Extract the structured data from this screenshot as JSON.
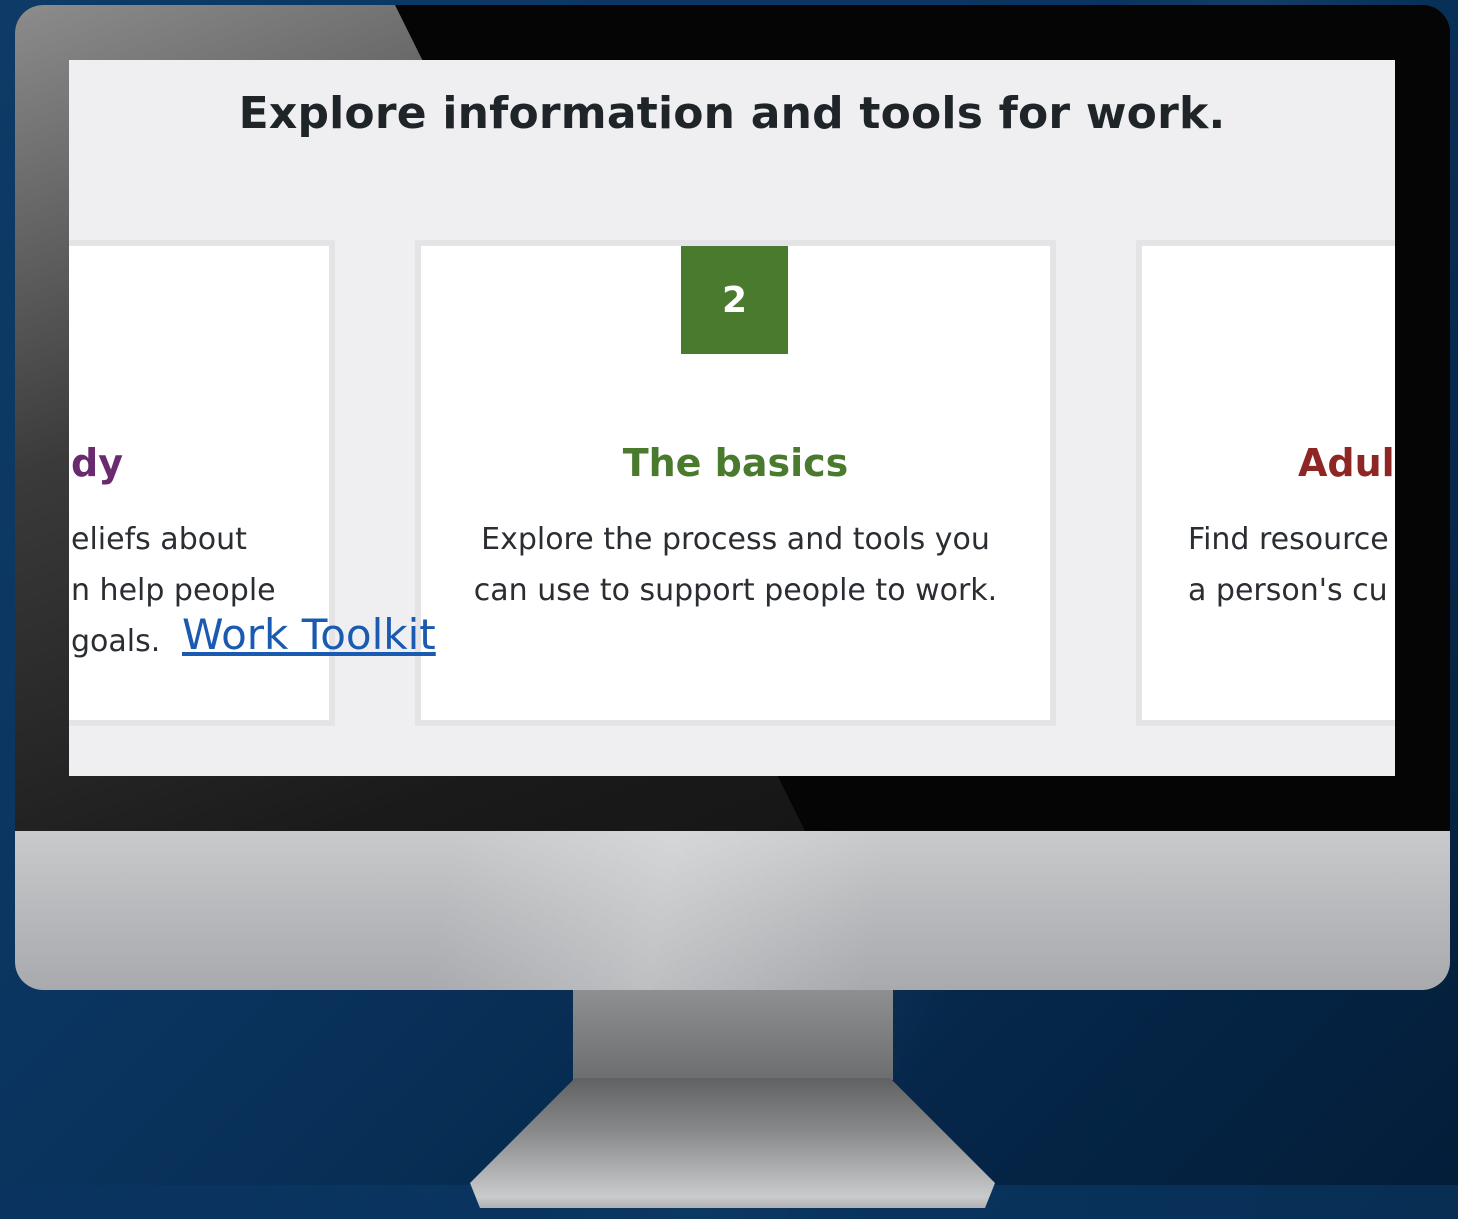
{
  "page": {
    "headline": "Explore information and tools for work."
  },
  "cards": {
    "left": {
      "title": "dy",
      "lines": [
        "eliefs about",
        "n help people",
        "goals."
      ]
    },
    "middle": {
      "badge": "2",
      "title": "The basics",
      "lines": [
        "Explore the process and tools you",
        "can use to support people to work."
      ]
    },
    "right": {
      "title": "Adul",
      "lines": [
        "Find resource",
        "a person's cu"
      ]
    }
  },
  "link": {
    "label": "Work Toolkit"
  },
  "colors": {
    "badge": "#4a7a2e",
    "middle_title": "#4a7a2e",
    "left_title": "#6a2a6e",
    "right_title": "#8e2626",
    "link": "#1a5ab0"
  }
}
